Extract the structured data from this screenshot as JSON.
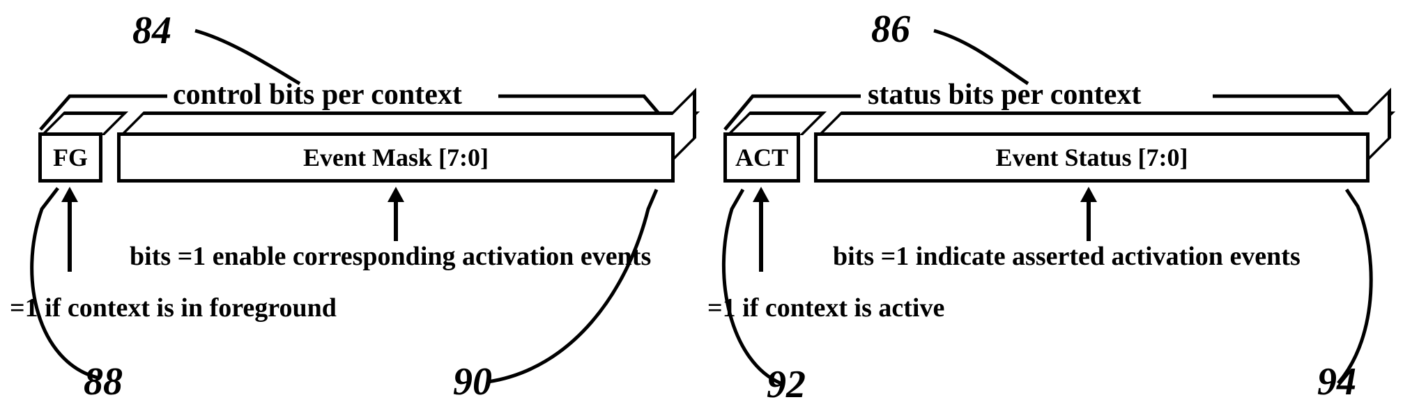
{
  "diagram": {
    "left": {
      "header": "control bits per context",
      "fg_label": "FG",
      "mask_label": "Event Mask [7:0]",
      "mask_desc": "bits =1 enable corresponding activation events",
      "fg_desc": "=1 if context is in foreground",
      "ref_header": "84",
      "ref_fg": "88",
      "ref_mask": "90"
    },
    "right": {
      "header": "status bits per context",
      "act_label": "ACT",
      "status_label": "Event Status [7:0]",
      "status_desc": "bits =1 indicate asserted activation events",
      "act_desc": "=1 if context is active",
      "ref_header": "86",
      "ref_act": "92",
      "ref_status": "94"
    }
  }
}
